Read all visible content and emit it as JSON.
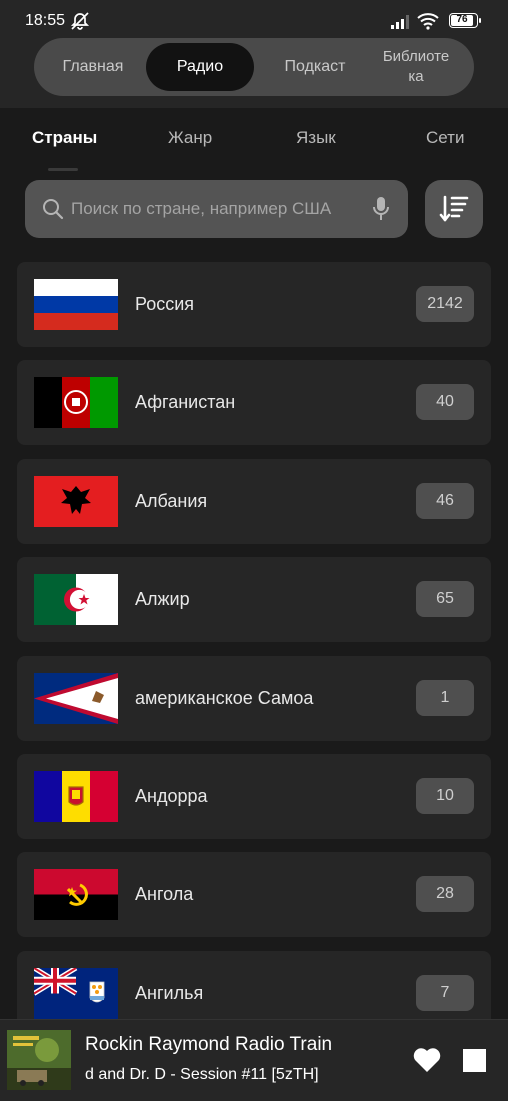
{
  "status_bar": {
    "time": "18:55",
    "battery": "76"
  },
  "nav": {
    "tabs": [
      {
        "label": "Главная"
      },
      {
        "label": "Радио"
      },
      {
        "label": "Подкаст"
      },
      {
        "label": "Библиоте ка"
      }
    ],
    "active": "Радио"
  },
  "subtabs": {
    "items": [
      {
        "label": "Страны"
      },
      {
        "label": "Жанр"
      },
      {
        "label": "Язык"
      },
      {
        "label": "Сети"
      }
    ],
    "active": "Страны"
  },
  "search": {
    "placeholder": "Поиск по стране, например США",
    "value": ""
  },
  "countries": [
    {
      "name": "Россия",
      "count": "2142",
      "flag_icon": "russia-flag-icon"
    },
    {
      "name": "Афганистан",
      "count": "40",
      "flag_icon": "afghanistan-flag-icon"
    },
    {
      "name": "Албания",
      "count": "46",
      "flag_icon": "albania-flag-icon"
    },
    {
      "name": "Алжир",
      "count": "65",
      "flag_icon": "algeria-flag-icon"
    },
    {
      "name": "американское Самоа",
      "count": "1",
      "flag_icon": "american-samoa-flag-icon"
    },
    {
      "name": "Андорра",
      "count": "10",
      "flag_icon": "andorra-flag-icon"
    },
    {
      "name": "Ангола",
      "count": "28",
      "flag_icon": "angola-flag-icon"
    },
    {
      "name": "Ангилья",
      "count": "7",
      "flag_icon": "anguilla-flag-icon"
    }
  ],
  "player": {
    "title": "Rockin Raymond Radio Train",
    "subtitle": "d and Dr. D - Session #11 [5zTH]",
    "icons": [
      "heart-icon",
      "stop-icon"
    ]
  }
}
